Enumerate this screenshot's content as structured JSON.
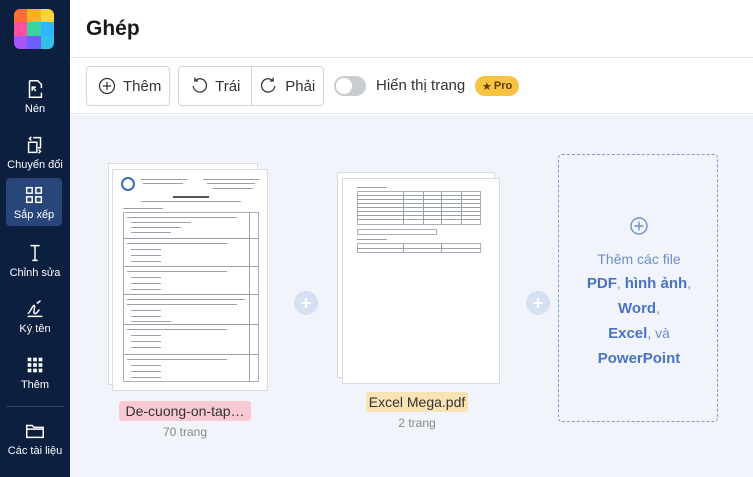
{
  "sidebar": {
    "logo_colors": [
      "#ff6b3d",
      "#ffb020",
      "#ffd43b",
      "#ff4fa0",
      "#38d39f",
      "#2fb5ff",
      "#a855f7",
      "#6d5dfc",
      "#33c0e8"
    ],
    "items": [
      {
        "label": "Nén",
        "icon": "compress-icon"
      },
      {
        "label": "Chuyển đổi",
        "icon": "convert-icon"
      },
      {
        "label": "Sắp xếp",
        "icon": "grid-icon"
      },
      {
        "label": "Chỉnh sửa",
        "icon": "text-cursor-icon"
      },
      {
        "label": "Ký tên",
        "icon": "signature-icon"
      },
      {
        "label": "Thêm",
        "icon": "more-apps-icon"
      },
      {
        "label": "Các tài liệu",
        "icon": "folder-icon"
      }
    ]
  },
  "header": {
    "title": "Ghép"
  },
  "toolbar": {
    "add_label": "Thêm",
    "rotate_left_label": "Trái",
    "rotate_right_label": "Phải",
    "show_pages_label": "Hiển thị trang",
    "show_pages_enabled": false,
    "pro_badge": "Pro"
  },
  "files": [
    {
      "name": "De-cuong-on-tap…",
      "pages": "70 trang",
      "badge_color": "#f8c9d2"
    },
    {
      "name": "Excel Mega.pdf",
      "pages": "2 trang",
      "badge_color": "#f7e3b3"
    }
  ],
  "drop_zone": {
    "line1": "Thêm các file",
    "pdf": "PDF",
    "images": "hình ảnh",
    "word": "Word",
    "excel": "Excel",
    "and": "và",
    "powerpoint": "PowerPoint"
  },
  "colors": {
    "sidebar_bg": "#0c1f3f",
    "sidebar_active": "#28467a",
    "canvas_bg": "#f1f4fa",
    "accent": "#4a74c3",
    "pro_badge": "#f6c342"
  }
}
